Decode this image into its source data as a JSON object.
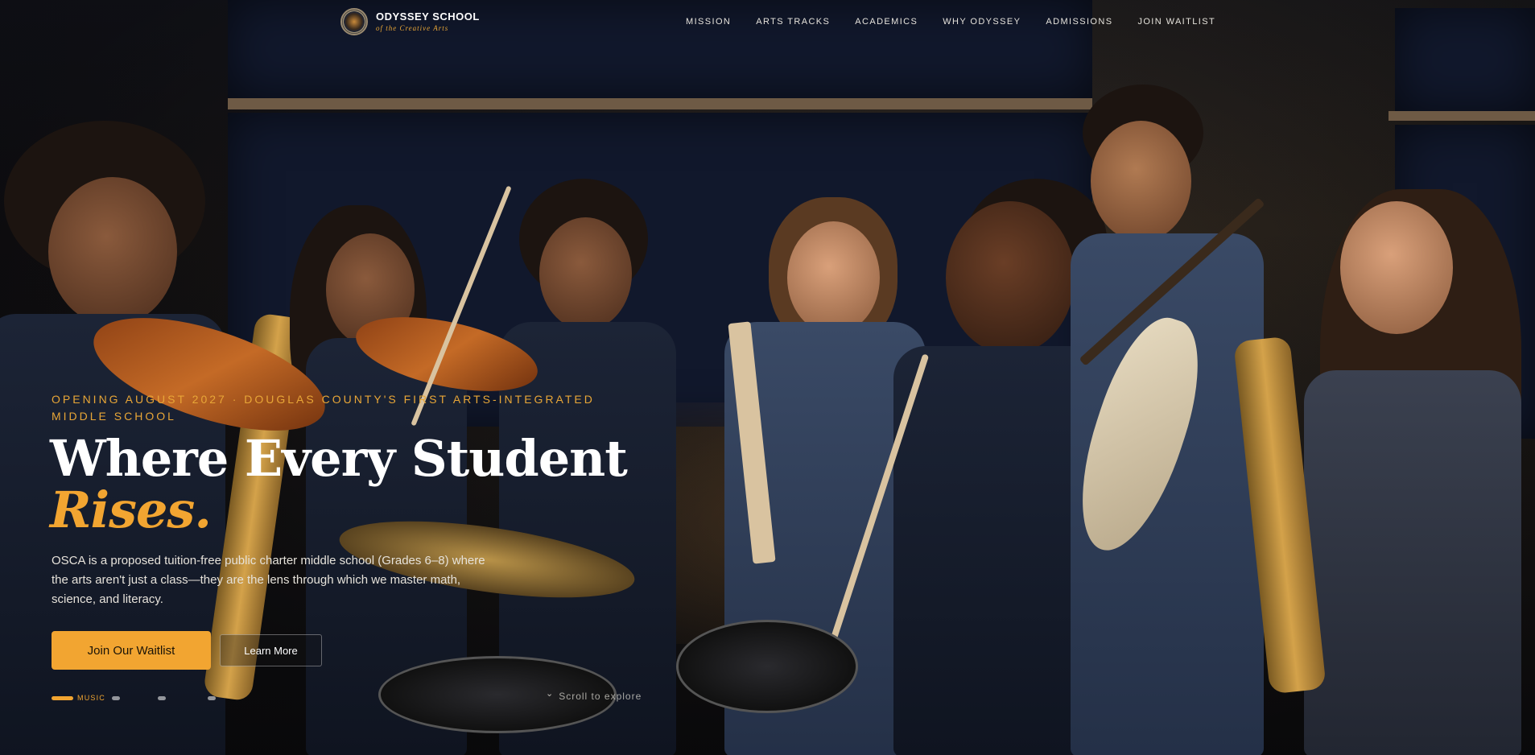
{
  "brand": {
    "name": "ODYSSEY SCHOOL",
    "tagline": "of the Creative Arts"
  },
  "nav": {
    "links": [
      "MISSION",
      "ARTS TRACKS",
      "ACADEMICS",
      "WHY ODYSSEY",
      "ADMISSIONS",
      "JOIN WAITLIST"
    ]
  },
  "hero": {
    "eyebrow": "OPENING AUGUST 2027 · DOUGLAS COUNTY'S FIRST ARTS-INTEGRATED MIDDLE SCHOOL",
    "headline_line1": "Where Every Student",
    "headline_accent": "Rises.",
    "lede": "OSCA is a proposed tuition-free public charter middle school (Grades 6–8) where the arts aren't just a class—they are the lens through which we master math, science, and literacy.",
    "primary_cta": "Join Our Waitlist",
    "secondary_cta": "Learn More"
  },
  "slider": {
    "active_label": "MUSIC",
    "active_index": 0,
    "count": 4
  },
  "scroll_hint": {
    "icon": "chevron-down-icon",
    "label": "Scroll to explore"
  },
  "colors": {
    "accent": "#f2a531",
    "text": "#ffffff"
  }
}
